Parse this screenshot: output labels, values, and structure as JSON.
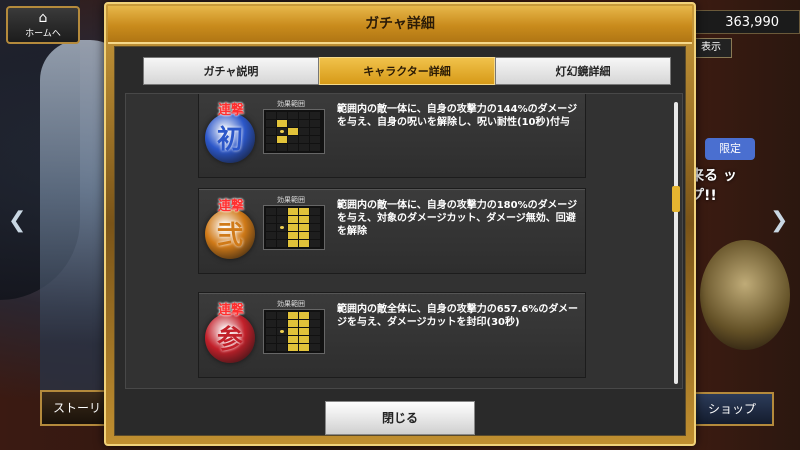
{
  "background": {
    "home_label": "ホームへ",
    "coin_value": "363,990",
    "display_label": "表示",
    "limited_label": "限定",
    "banner_text": "来る ップ!!",
    "story_label": "ストーリ",
    "shop_label": "ショップ"
  },
  "modal": {
    "title": "ガチャ詳細",
    "tabs": [
      {
        "label": "ガチャ説明",
        "active": false
      },
      {
        "label": "キャラクター詳細",
        "active": true
      },
      {
        "label": "灯幻鏡詳細",
        "active": false
      }
    ],
    "range_label": "効果範囲",
    "skills": [
      {
        "badge_top": "連撃",
        "badge_main": "初",
        "badge_color": "#2c57c9",
        "description": "範囲内の敵一体に、自身の攻撃力の144%のダメージを与え、自身の呪いを解除し、呪い耐性(10秒)付与",
        "grid": [
          0,
          0,
          0,
          0,
          0,
          0,
          1,
          0,
          0,
          0,
          0,
          2,
          1,
          0,
          0,
          0,
          1,
          0,
          0,
          0,
          0,
          0,
          0,
          0,
          0
        ]
      },
      {
        "badge_top": "連撃",
        "badge_main": "弐",
        "badge_color": "#d07a18",
        "description": "範囲内の敵一体に、自身の攻撃力の180%のダメージを与え、対象のダメージカット、ダメージ無効、回避を解除",
        "grid": [
          0,
          0,
          1,
          1,
          0,
          0,
          0,
          1,
          1,
          0,
          0,
          2,
          1,
          1,
          0,
          0,
          0,
          1,
          1,
          0,
          0,
          0,
          1,
          1,
          0
        ]
      },
      {
        "badge_top": "連撃",
        "badge_main": "参",
        "badge_color": "#c2202a",
        "description": "範囲内の敵全体に、自身の攻撃力の657.6%のダメージを与え、ダメージカットを封印(30秒)",
        "grid": [
          0,
          0,
          1,
          1,
          0,
          0,
          0,
          1,
          1,
          0,
          0,
          2,
          1,
          1,
          0,
          0,
          0,
          1,
          1,
          0,
          0,
          0,
          1,
          1,
          0
        ]
      }
    ],
    "close_label": "閉じる"
  },
  "colors": {
    "accent": "#e2b43a",
    "title_text": "#2b1b07"
  }
}
